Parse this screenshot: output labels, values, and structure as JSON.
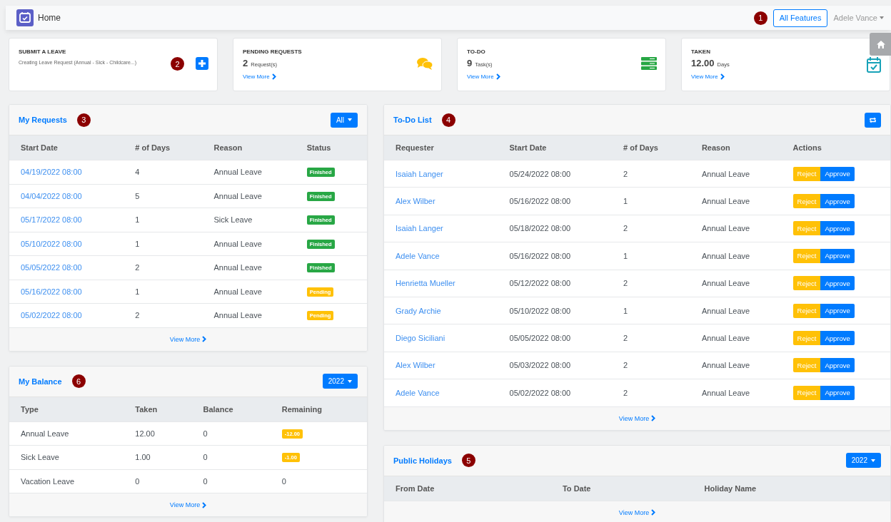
{
  "header": {
    "title": "Home",
    "annotation": "1",
    "features_button": "All Features",
    "user": "Adele Vance"
  },
  "summary_cards": [
    {
      "kind": "submit",
      "title": "SUBMIT A LEAVE",
      "description": "Creating Leave Request (Annual - Sick - Childcare...)",
      "annotation": "2"
    },
    {
      "kind": "pending",
      "title": "PENDING REQUESTS",
      "value": "2",
      "unit": "Request(s)",
      "link": "View More"
    },
    {
      "kind": "todo",
      "title": "TO-DO",
      "value": "9",
      "unit": "Task(s)",
      "link": "View More"
    },
    {
      "kind": "taken",
      "title": "TAKEN",
      "value": "12.00",
      "unit": "Days",
      "link": "View More"
    }
  ],
  "my_requests": {
    "title": "My Requests",
    "annotation": "3",
    "filter": "All",
    "columns": [
      "Start Date",
      "# of Days",
      "Reason",
      "Status"
    ],
    "rows": [
      {
        "start_date": "04/19/2022 08:00",
        "days": "4",
        "reason": "Annual Leave",
        "status": {
          "label": "Finished",
          "kind": "finished"
        }
      },
      {
        "start_date": "04/04/2022 08:00",
        "days": "5",
        "reason": "Annual Leave",
        "status": {
          "label": "Finished",
          "kind": "finished"
        }
      },
      {
        "start_date": "05/17/2022 08:00",
        "days": "1",
        "reason": "Sick Leave",
        "status": {
          "label": "Finished",
          "kind": "finished"
        }
      },
      {
        "start_date": "05/10/2022 08:00",
        "days": "1",
        "reason": "Annual Leave",
        "status": {
          "label": "Finished",
          "kind": "finished"
        }
      },
      {
        "start_date": "05/05/2022 08:00",
        "days": "2",
        "reason": "Annual Leave",
        "status": {
          "label": "Finished",
          "kind": "finished"
        }
      },
      {
        "start_date": "05/16/2022 08:00",
        "days": "1",
        "reason": "Annual Leave",
        "status": {
          "label": "Pending",
          "kind": "pending"
        }
      },
      {
        "start_date": "05/02/2022 08:00",
        "days": "2",
        "reason": "Annual Leave",
        "status": {
          "label": "Pending",
          "kind": "pending"
        }
      }
    ],
    "footer_link": "View More"
  },
  "my_balance": {
    "title": "My Balance",
    "annotation": "6",
    "year": "2022",
    "columns": [
      "Type",
      "Taken",
      "Balance",
      "Remaining"
    ],
    "rows": [
      {
        "type": "Annual Leave",
        "taken": "12.00",
        "balance": "0",
        "remaining": "-12.00",
        "negative": true
      },
      {
        "type": "Sick Leave",
        "taken": "1.00",
        "balance": "0",
        "remaining": "-1.00",
        "negative": true
      },
      {
        "type": "Vacation Leave",
        "taken": "0",
        "balance": "0",
        "remaining": "0",
        "negative": false
      }
    ],
    "footer_link": "View More"
  },
  "to_do_list": {
    "title": "To-Do List",
    "annotation": "4",
    "columns": [
      "Requester",
      "Start Date",
      "# of Days",
      "Reason",
      "Actions"
    ],
    "rows": [
      {
        "requester": "Isaiah Langer",
        "start_date": "05/24/2022 08:00",
        "days": "2",
        "reason": "Annual Leave",
        "reject": "Reject",
        "approve": "Approve"
      },
      {
        "requester": "Alex Wilber",
        "start_date": "05/16/2022 08:00",
        "days": "1",
        "reason": "Annual Leave",
        "reject": "Reject",
        "approve": "Approve"
      },
      {
        "requester": "Isaiah Langer",
        "start_date": "05/18/2022 08:00",
        "days": "2",
        "reason": "Annual Leave",
        "reject": "Reject",
        "approve": "Approve"
      },
      {
        "requester": "Adele Vance",
        "start_date": "05/16/2022 08:00",
        "days": "1",
        "reason": "Annual Leave",
        "reject": "Reject",
        "approve": "Approve"
      },
      {
        "requester": "Henrietta Mueller",
        "start_date": "05/12/2022 08:00",
        "days": "2",
        "reason": "Annual Leave",
        "reject": "Reject",
        "approve": "Approve"
      },
      {
        "requester": "Grady Archie",
        "start_date": "05/10/2022 08:00",
        "days": "1",
        "reason": "Annual Leave",
        "reject": "Reject",
        "approve": "Approve"
      },
      {
        "requester": "Diego Siciliani",
        "start_date": "05/05/2022 08:00",
        "days": "2",
        "reason": "Annual Leave",
        "reject": "Reject",
        "approve": "Approve"
      },
      {
        "requester": "Alex Wilber",
        "start_date": "05/03/2022 08:00",
        "days": "2",
        "reason": "Annual Leave",
        "reject": "Reject",
        "approve": "Approve"
      },
      {
        "requester": "Adele Vance",
        "start_date": "05/02/2022 08:00",
        "days": "2",
        "reason": "Annual Leave",
        "reject": "Reject",
        "approve": "Approve"
      }
    ],
    "footer_link": "View More"
  },
  "public_holidays": {
    "title": "Public Holidays",
    "annotation": "5",
    "year": "2022",
    "columns": [
      "From Date",
      "To Date",
      "Holiday Name"
    ],
    "footer_link": "View More"
  }
}
